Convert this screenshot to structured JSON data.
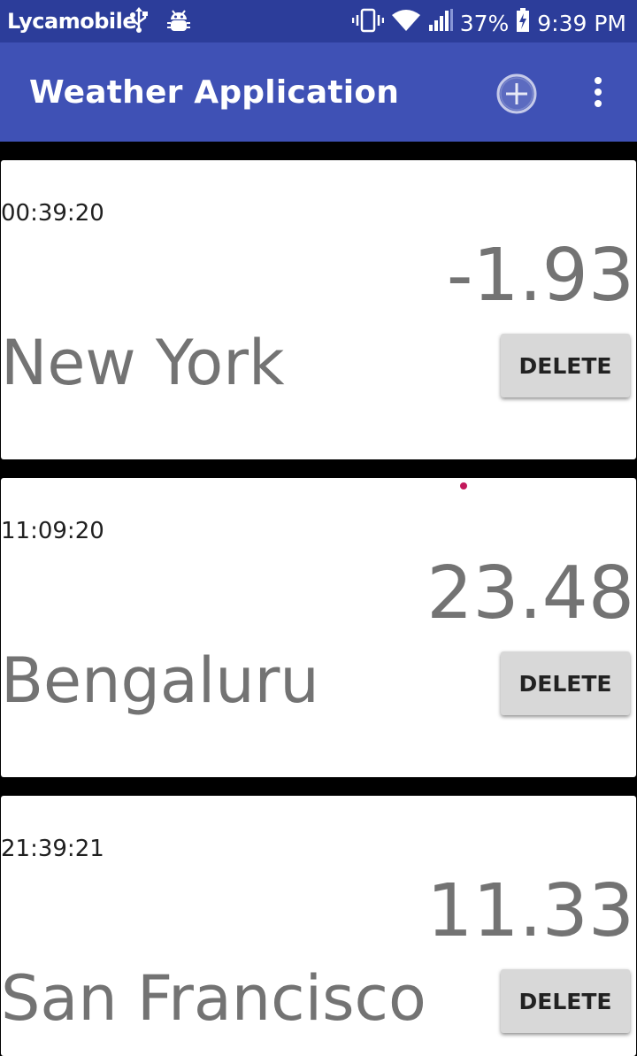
{
  "status_bar": {
    "carrier": "Lycamobile",
    "battery_percent": "37%",
    "time": "9:39 PM",
    "icons": [
      "usb-icon",
      "android-debug-icon",
      "vibrate-icon",
      "wifi-icon",
      "signal-icon",
      "battery-charging-icon"
    ]
  },
  "app_bar": {
    "title": "Weather Application",
    "add_icon": "add-circle-icon",
    "menu_icon": "overflow-menu-icon",
    "color": "#3f51b5"
  },
  "cities": [
    {
      "time": "00:39:20",
      "temperature": "-1.93",
      "name": "New York",
      "delete_label": "DELETE"
    },
    {
      "time": "11:09:20",
      "temperature": "23.48",
      "name": "Bengaluru",
      "delete_label": "DELETE"
    },
    {
      "time": "21:39:21",
      "temperature": "11.33",
      "name": "San Francisco",
      "delete_label": "DELETE"
    }
  ]
}
